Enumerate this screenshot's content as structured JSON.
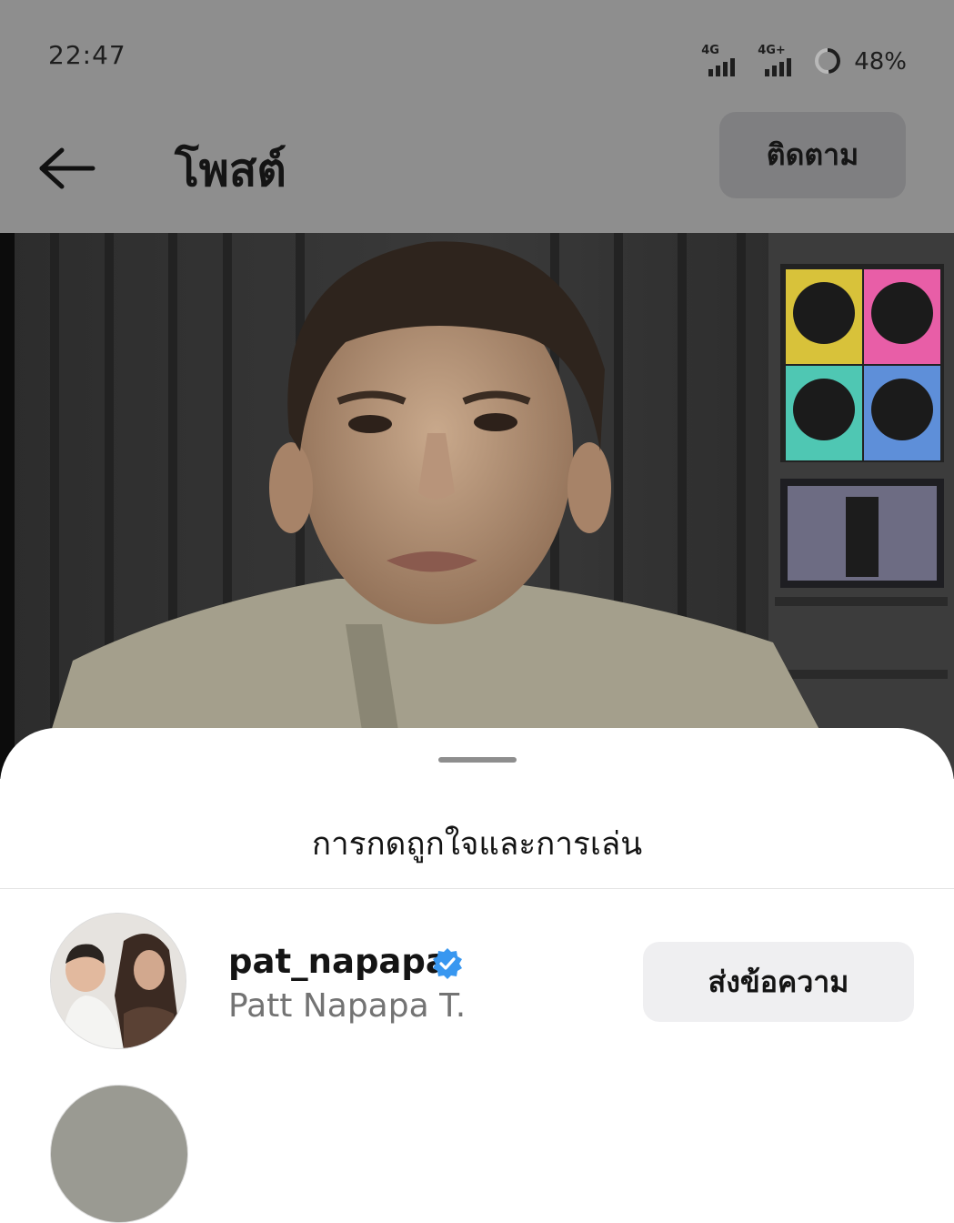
{
  "status_bar": {
    "time": "22:47",
    "network_1": "4G",
    "network_2": "4G+",
    "battery": "48%"
  },
  "nav": {
    "title": "โพสต์",
    "follow_label": "ติดตาม",
    "back_icon": "arrow-left-icon"
  },
  "sheet": {
    "title": "การกดถูกใจและการเล่น",
    "users": [
      {
        "username": "pat_napapa",
        "full_name": "Patt Napapa T.",
        "verified": true,
        "action_label": "ส่งข้อความ"
      }
    ]
  },
  "colors": {
    "dim_overlay": "#8e8e8e",
    "verified_badge": "#3897f0",
    "button_bg": "#efeff1"
  }
}
